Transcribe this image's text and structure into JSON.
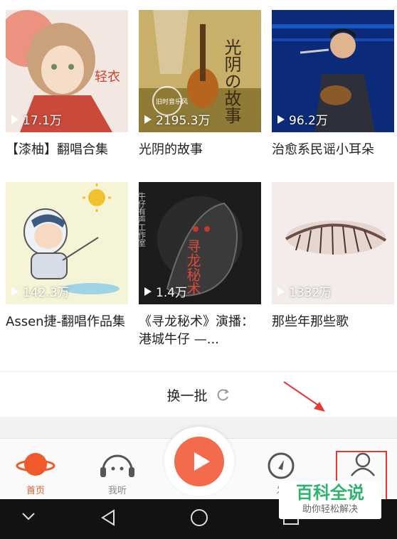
{
  "playlists": [
    {
      "plays": "17.1万",
      "title": "【漆柚】翻唱合集"
    },
    {
      "plays": "2195.3万",
      "title": "光阴的故事"
    },
    {
      "plays": "96.2万",
      "title": "治愈系民谣小耳朵"
    },
    {
      "plays": "142.3万",
      "title": "Assen捷-翻唱作品集"
    },
    {
      "plays": "1.4万",
      "title": "《寻龙秘术》演播：港城牛仔 —..."
    },
    {
      "plays": "1332万",
      "title": "那些年那些歌"
    }
  ],
  "cover_text": {
    "c1": "轻衣",
    "c2_title": "光阴の故事",
    "c2_stamp": "旧时音乐风",
    "c5_title": "寻龙秘术",
    "c5_side": "牛仔有声工作室"
  },
  "refresh_label": "换一批",
  "tabs": {
    "home": "首页",
    "listen": "我听",
    "discover": "发",
    "profile": ""
  },
  "watermark": {
    "title": "百科全说",
    "subtitle": "助你轻松解决"
  },
  "colors": {
    "accent": "#f05a2b",
    "play": "#f36b4a",
    "annotation": "#e53935"
  }
}
